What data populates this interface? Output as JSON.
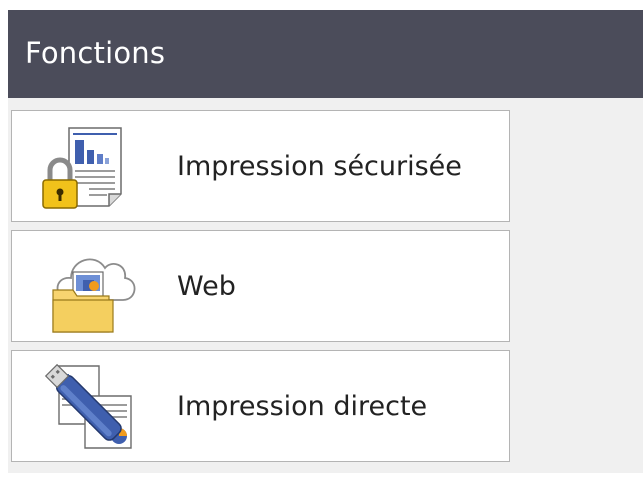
{
  "header": {
    "title": "Fonctions"
  },
  "menu": {
    "items": [
      {
        "label": "Impression sécurisée",
        "icon": "secure-print-lock-icon"
      },
      {
        "label": "Web",
        "icon": "web-cloud-folder-icon"
      },
      {
        "label": "Impression directe",
        "icon": "usb-direct-print-icon"
      }
    ]
  }
}
